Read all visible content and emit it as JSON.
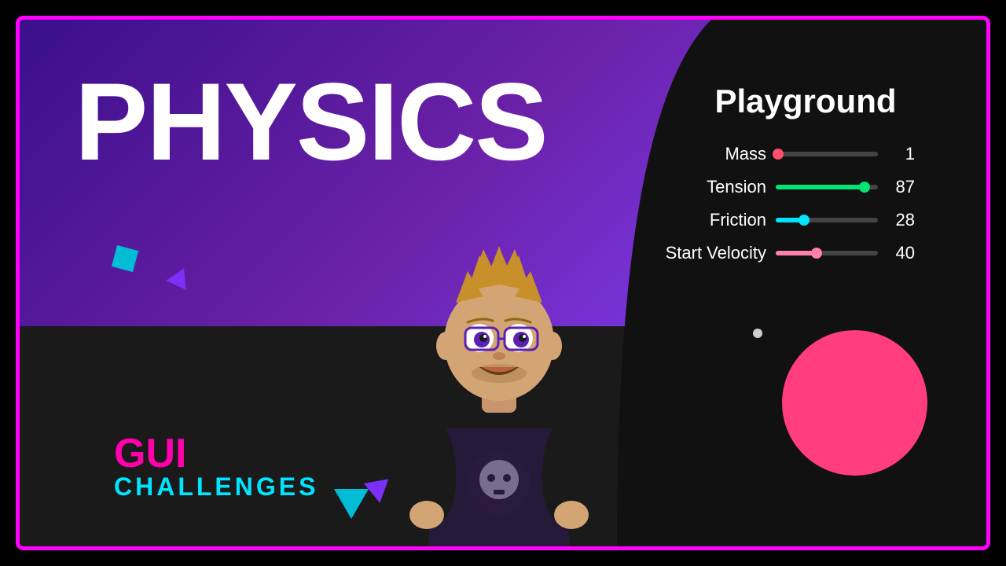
{
  "title": "Physics Playground",
  "main": {
    "physics_label": "PHYSICS",
    "gui_label": "GUI",
    "challenges_label": "CHALLENGES"
  },
  "playground": {
    "title": "Playground",
    "sliders": [
      {
        "label": "Mass",
        "value": 1,
        "percent": 2,
        "color": "#ff4d6d",
        "fill_color": "#ff4d6d"
      },
      {
        "label": "Tension",
        "value": 87,
        "percent": 87,
        "color": "#00e676",
        "fill_color": "#00e676"
      },
      {
        "label": "Friction",
        "value": 28,
        "percent": 28,
        "color": "#00e5ff",
        "fill_color": "#00e5ff"
      },
      {
        "label": "Start Velocity",
        "value": 40,
        "percent": 40,
        "color": "#ff80ab",
        "fill_color": "#ff80ab"
      }
    ]
  },
  "ball": {
    "color": "#ff3d7f"
  }
}
